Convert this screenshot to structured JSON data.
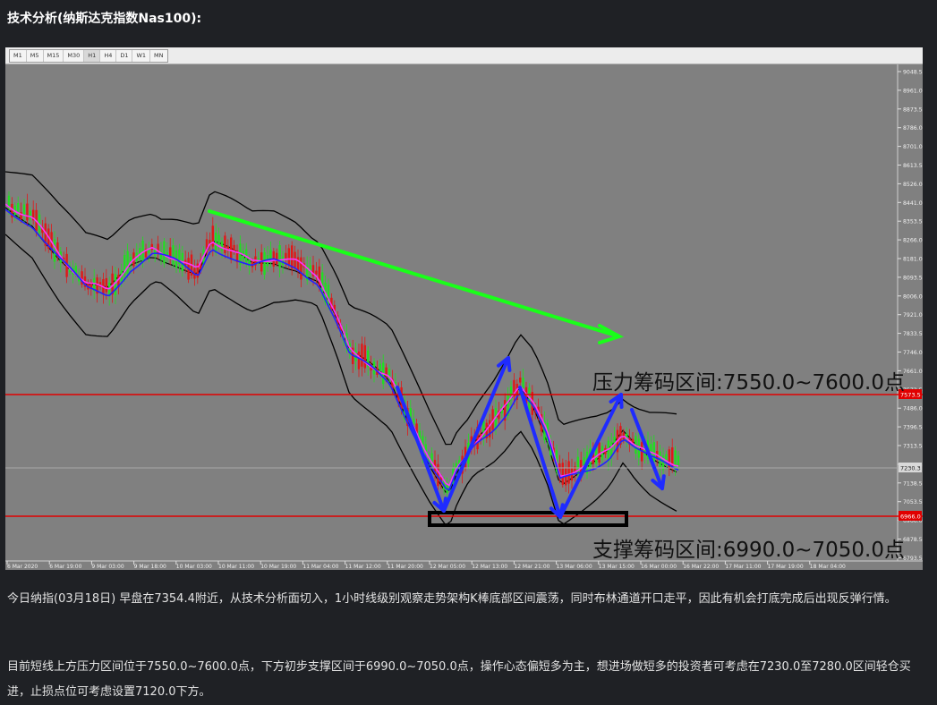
{
  "heading": "技术分析(纳斯达克指数Nas100):",
  "timeframes": [
    "M1",
    "M5",
    "M15",
    "M30",
    "H1",
    "H4",
    "D1",
    "W1",
    "MN"
  ],
  "active_timeframe": "H1",
  "annotations": {
    "resistance_label": "压力筹码区间:7550.0~7600.0点",
    "support_label": "支撑筹码区间:6990.0~7050.0点"
  },
  "price_axis": [
    "9048.5",
    "8961.0",
    "8873.5",
    "8786.0",
    "8701.0",
    "8613.5",
    "8526.0",
    "8441.0",
    "8353.5",
    "8266.0",
    "8181.0",
    "8093.5",
    "8006.0",
    "7921.0",
    "7833.5",
    "7746.0",
    "7661.0",
    "7573.5",
    "7486.0",
    "7396.5",
    "7313.5",
    "7228.5",
    "7138.5",
    "7053.5",
    "6966.0",
    "6878.5",
    "6793.5"
  ],
  "time_axis": [
    "6 Mar 2020",
    "6 Mar 19:00",
    "9 Mar 03:00",
    "9 Mar 18:00",
    "10 Mar 03:00",
    "10 Mar 11:00",
    "10 Mar 19:00",
    "11 Mar 04:00",
    "11 Mar 12:00",
    "11 Mar 20:00",
    "12 Mar 05:00",
    "12 Mar 13:00",
    "12 Mar 21:00",
    "13 Mar 06:00",
    "13 Mar 15:00",
    "16 Mar 00:00",
    "16 Mar 22:00",
    "17 Mar 11:00",
    "17 Mar 19:00",
    "18 Mar 04:00"
  ],
  "price_tags": {
    "current": "7230.3",
    "resistance_line": "7573.5",
    "support_line": "6966.0"
  },
  "colors": {
    "resistance_line": "#e00000",
    "support_line": "#e00000",
    "trend_arrow": "#19ff19",
    "wave_arrows": "#1f2bff",
    "bull_candle": "#22dd22",
    "bear_candle": "#e01818",
    "bollinger": "#000000",
    "ma_fast": "#ff33ff",
    "ma_slow": "#2222ff"
  },
  "paragraphs": {
    "p1": "今日纳指(03月18日) 早盘在7354.4附近，从技术分析面切入，1小时线级别观察走势架构K棒底部区间震荡，同时布林通道开口走平，因此有机会打底完成后出现反弹行情。",
    "p2": "目前短线上方压力区间位于7550.0~7600.0点，下方初步支撑区间于6990.0~7050.0点，操作心态偏短多为主，想进场做短多的投资者可考虑在7230.0至7280.0区间轻仓买进，止损点位可考虑设置7120.0下方。"
  }
}
